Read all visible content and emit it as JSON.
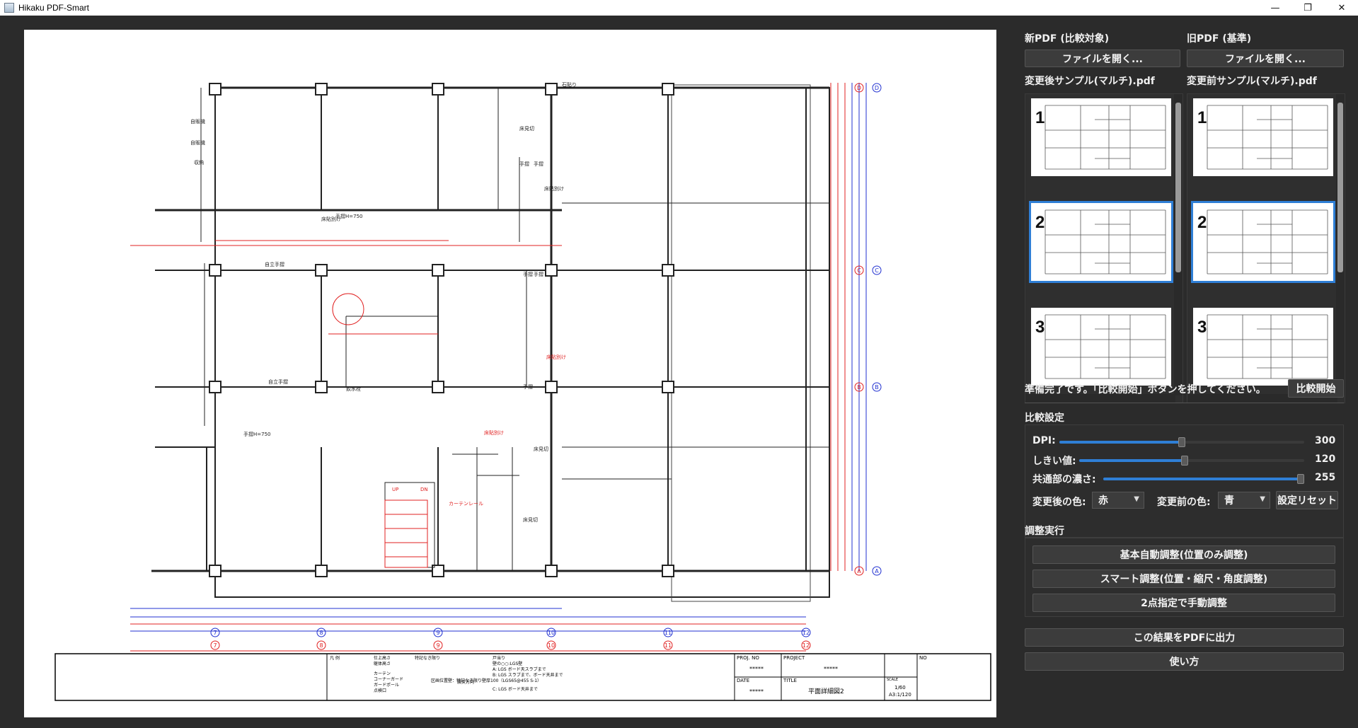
{
  "window": {
    "title": "Hikaku PDF-Smart",
    "minimize": "—",
    "maximize": "❐",
    "close": "✕"
  },
  "new_pdf": {
    "header": "新PDF (比較対象)",
    "open_button": "ファイルを開く...",
    "filename": "変更後サンプル(マルチ).pdf",
    "pages": [
      "1",
      "2",
      "3"
    ],
    "selected_page": "2"
  },
  "old_pdf": {
    "header": "旧PDF (基準)",
    "open_button": "ファイルを開く...",
    "filename": "変更前サンプル(マルチ).pdf",
    "pages": [
      "1",
      "2",
      "3"
    ],
    "selected_page": "2"
  },
  "status": {
    "message": "準備完了です。「比較開始」ボタンを押してください。",
    "start_button": "比較開始"
  },
  "settings": {
    "header": "比較設定",
    "dpi": {
      "label": "DPI:",
      "value": "300",
      "level": 0.5
    },
    "threshold": {
      "label": "しきい値:",
      "value": "120",
      "level": 0.47
    },
    "common_density": {
      "label": "共通部の濃さ:",
      "value": "255",
      "level": 1.0
    },
    "new_color": {
      "label": "変更後の色:",
      "value": "赤"
    },
    "old_color": {
      "label": "変更前の色:",
      "value": "青"
    },
    "reset_button": "設定リセット"
  },
  "adjust": {
    "header": "調整実行",
    "auto_button": "基本自動調整(位置のみ調整)",
    "smart_button": "スマート調整(位置・縮尺・角度調整)",
    "manual_button": "2点指定で手動調整"
  },
  "export_button": "この結果をPDFに出力",
  "help_button": "使い方",
  "drawing": {
    "grid_top": [
      "⑦",
      "⑧",
      "⑨",
      "⑩",
      "⑪",
      "⑫"
    ],
    "grid_bottom": [
      "7",
      "8",
      "9",
      "10",
      "11",
      "12"
    ],
    "grid_right": [
      "D",
      "C",
      "B",
      "A"
    ],
    "title_block": {
      "proj_no_label": "PROJ. NO",
      "proj_no": "*****",
      "project_label": "PROJECT",
      "project": "*****",
      "no_label": "NO",
      "date_label": "DATE",
      "date": "*****",
      "title_label": "TITLE",
      "title": "平面詳細図2",
      "scale_label": "SCALE",
      "scale": "1/60",
      "scale2": "A3:1/120"
    },
    "legend": [
      "凡 例",
      "仕上高さ",
      "躯体高さ",
      "特記なき限り",
      "カーテン",
      "コーナーガード",
      "ガードポール",
      "点検口",
      "戸当り",
      "壁の○○:LGS壁",
      "A: LGS ボード天スラブまで",
      "B: LGS スラブまで、ボード天井まで",
      "C: LGS ボード天井まで",
      "区画位置壁：特記なき限り壁厚100（LGS65@455 S-1）",
      "震災方向"
    ],
    "room_labels": [
      "自販機",
      "自販機",
      "収納",
      "床見切",
      "手摺",
      "手摺",
      "床貼別け",
      "床貼別け",
      "手摺H=750",
      "自立手摺",
      "自立手摺",
      "飲水栓",
      "手摺",
      "手摺",
      "床貼別け",
      "手摺",
      "床見切",
      "床見切",
      "手摺H=750",
      "UP",
      "DN",
      "カーテンレール",
      "床貼別け",
      "石貼り"
    ]
  }
}
